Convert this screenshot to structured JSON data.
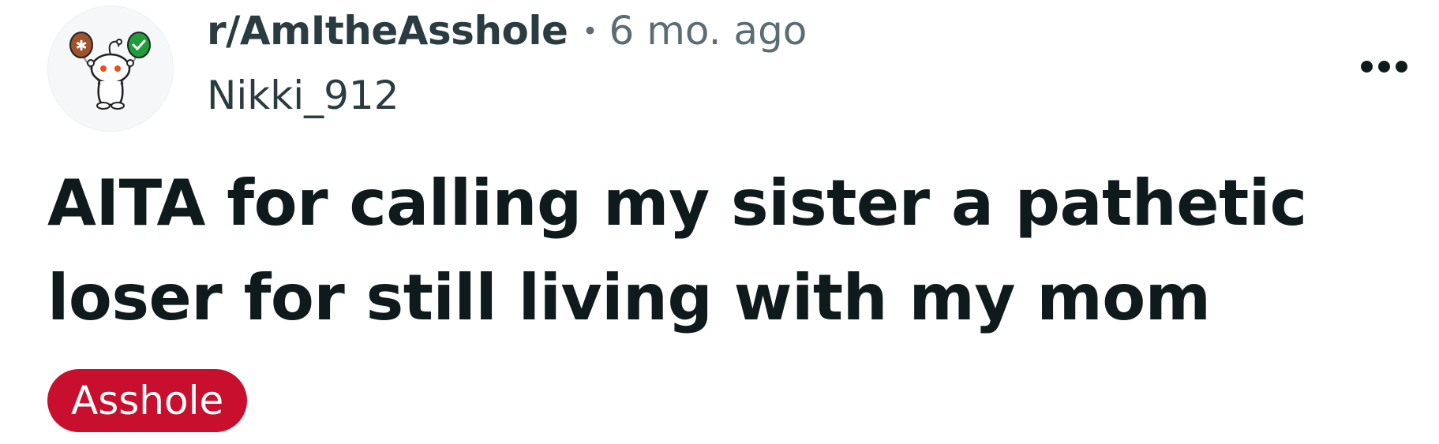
{
  "post": {
    "subreddit": "r/AmItheAsshole",
    "separator": "•",
    "timestamp": "6 mo. ago",
    "username": "Nikki_912",
    "title": "AITA for calling my sister a pathetic loser for still living with my mom",
    "flair": "Asshole",
    "flair_color": "#c8102e"
  },
  "icons": {
    "avatar": "subreddit-avatar-snoo-icon",
    "menu": "overflow-menu-icon"
  }
}
